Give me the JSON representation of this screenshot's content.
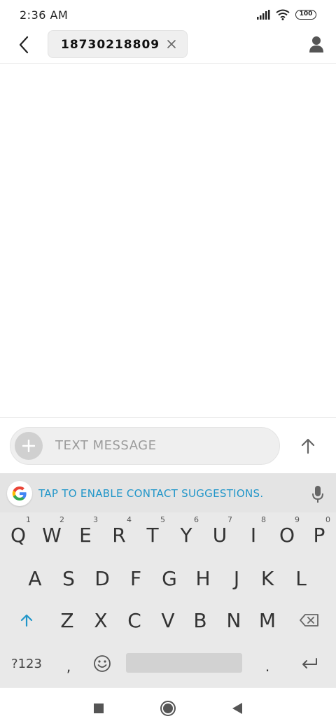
{
  "status_bar": {
    "time": "2:36 AM",
    "battery": "100"
  },
  "header": {
    "recipient": "18730218809"
  },
  "compose": {
    "placeholder": "TEXT MESSAGE"
  },
  "keyboard": {
    "suggestion": "TAP TO ENABLE CONTACT SUGGESTIONS.",
    "row1": [
      {
        "key": "Q",
        "hint": "1"
      },
      {
        "key": "W",
        "hint": "2"
      },
      {
        "key": "E",
        "hint": "3"
      },
      {
        "key": "R",
        "hint": "4"
      },
      {
        "key": "T",
        "hint": "5"
      },
      {
        "key": "Y",
        "hint": "6"
      },
      {
        "key": "U",
        "hint": "7"
      },
      {
        "key": "I",
        "hint": "8"
      },
      {
        "key": "O",
        "hint": "9"
      },
      {
        "key": "P",
        "hint": "0"
      }
    ],
    "row2": [
      "A",
      "S",
      "D",
      "F",
      "G",
      "H",
      "J",
      "K",
      "L"
    ],
    "row3": [
      "Z",
      "X",
      "C",
      "V",
      "B",
      "N",
      "M"
    ],
    "row4": {
      "symbols": "?123",
      "comma": ",",
      "period": "."
    }
  },
  "colors": {
    "accent": "#2196c9",
    "keyboard_bg": "#e9e9e9",
    "text": "#333333"
  },
  "icons": {
    "back": "back-arrow-icon",
    "close": "close-icon",
    "contact": "person-icon",
    "attach": "plus-icon",
    "send": "arrow-up-icon",
    "google": "google-g-icon",
    "mic": "microphone-icon",
    "shift": "shift-arrow-icon",
    "backspace": "backspace-icon",
    "emoji": "emoji-icon",
    "enter": "enter-icon",
    "nav_recents": "square-icon",
    "nav_home": "circle-icon",
    "nav_back": "triangle-back-icon"
  }
}
